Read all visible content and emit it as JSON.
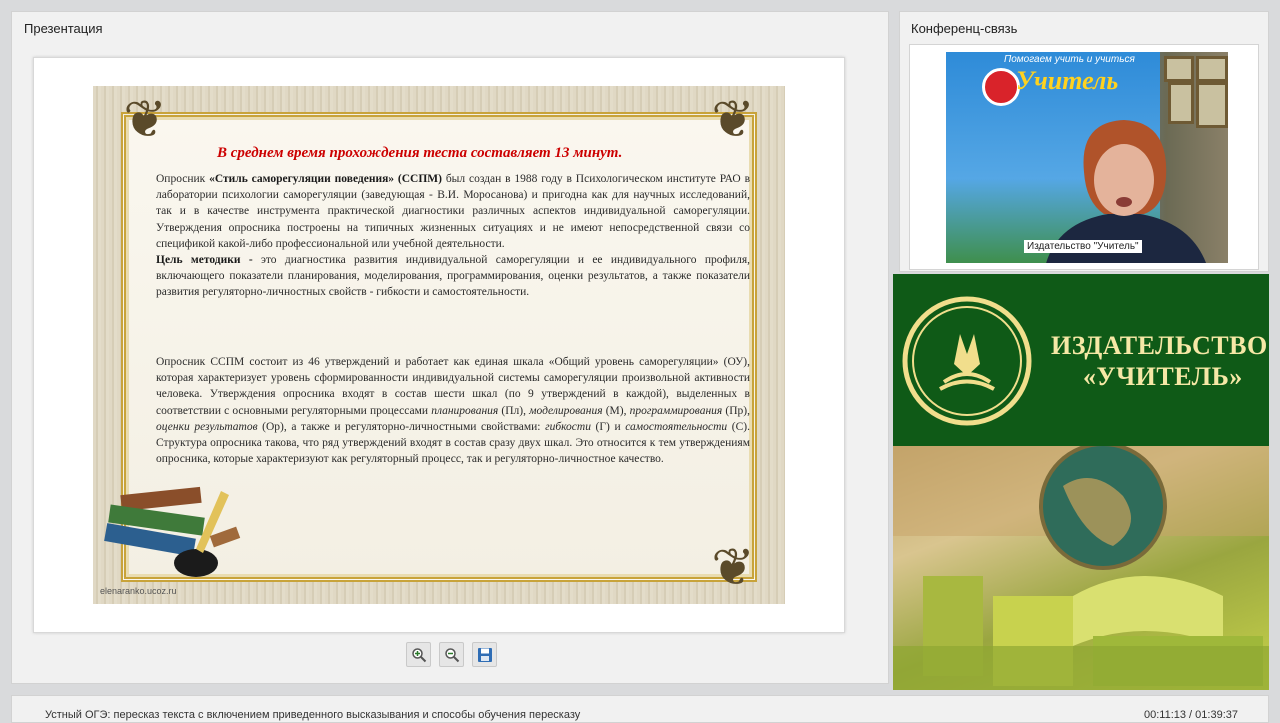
{
  "presentation": {
    "title": "Презентация",
    "slide": {
      "heading": "В среднем время прохождения теста составляет 13 минут.",
      "p1_intro": "Опросник ",
      "p1_bold1": "«Стиль саморегуляции поведения» (ССПМ)",
      "p1_rest": " был создан в 1988 году в Психологическом институте РАО в лаборатории психологии саморегуляции (заведующая - В.И. Моросанова) и пригодна как для научных исследований, так и в качестве инструмента практической диагностики различных аспектов индивидуальной саморегуляции. Утверждения опросника построены на типичных жизненных ситуациях и не имеют непосредственной связи со спецификой какой-либо профессиональной или учебной деятельности.",
      "p1_bold2": "Цель методики -",
      "p1_rest2": " это диагностика развития индивидуальной саморегуляции и ее индивидуального профиля, включающего показатели планирования, моделирования, программирования, оценки результатов, а также показатели развития регуляторно-личностных свойств - гибкости и самостоятельности.",
      "p2_a": "Опросник ССПМ состоит из 46 утверждений и работает как единая шкала «Общий уровень саморегуляции» (ОУ), которая характеризует уровень сформированности индивидуальной системы саморегуляции произвольной активности человека. Утверждения опросника входят в состав шести шкал (по 9 утверждений в каждой), выделенных в соответствии с основными регуляторными процессами ",
      "p2_i1": "планирования",
      "p2_b": " (Пл), ",
      "p2_i2": "моделирования",
      "p2_c": " (М), ",
      "p2_i3": "программирования",
      "p2_d": " (Пр), ",
      "p2_i4": "оценки результатов",
      "p2_e": " (Ор), а также и регуляторно-личностными свойствами: ",
      "p2_i5": "гибкости",
      "p2_f": " (Г) и ",
      "p2_i6": "самостоятельности",
      "p2_g": " (С). Структура опросника такова, что ряд утверждений входят в состав сразу двух шкал. Это относится к тем утверждениям опросника, которые характеризуют как регуляторный процесс, так и регуляторно-личностное качество.",
      "watermark": "elenaranko.ucoz.ru"
    },
    "tools": [
      "zoom-in-icon",
      "zoom-out-icon",
      "save-icon"
    ]
  },
  "conference": {
    "title": "Конференц-связь",
    "banner_top": "Помогаем учить и учиться",
    "banner_logo": "Учитель",
    "camera_label": "Издательство \"Учитель\""
  },
  "publisher": {
    "line1": "ИЗДАТЕЛЬСТВО",
    "line2": "«УЧИТЕЛЬ»",
    "brand_color": "#0f5a17"
  },
  "footer": {
    "course_title": "Устный ОГЭ: пересказ текста с включением приведенного высказывания и способы обучения пересказу",
    "timer": "00:11:13 / 01:39:37"
  }
}
